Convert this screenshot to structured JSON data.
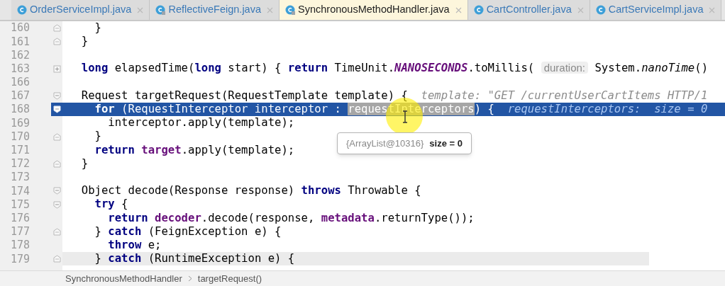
{
  "tabs": [
    {
      "name": "OrderServiceImpl.java",
      "selected": false,
      "library": false
    },
    {
      "name": "ReflectiveFeign.java",
      "selected": false,
      "library": true
    },
    {
      "name": "SynchronousMethodHandler.java",
      "selected": true,
      "library": true
    },
    {
      "name": "CartController.java",
      "selected": false,
      "library": false
    },
    {
      "name": "CartServiceImpl.java",
      "selected": false,
      "library": false
    }
  ],
  "lines": [
    {
      "number": "160",
      "fold_marker": {
        "kind": "end"
      },
      "execution": false,
      "caret": false,
      "tokens": [
        {
          "text": "    }",
          "kind": "plain"
        }
      ]
    },
    {
      "number": "161",
      "fold_marker": {
        "kind": "end"
      },
      "execution": false,
      "caret": false,
      "tokens": [
        {
          "text": "  }",
          "kind": "plain"
        }
      ]
    },
    {
      "number": "162",
      "execution": false,
      "caret": false
    },
    {
      "number": "163",
      "fold_marker": {
        "kind": "plus"
      },
      "execution": false,
      "caret": false,
      "tokens": [
        {
          "text": "  long",
          "kind": "keyword"
        },
        {
          "text": " elapsedTime(",
          "kind": "plain"
        },
        {
          "text": "long",
          "kind": "keyword"
        },
        {
          "text": " start) { ",
          "kind": "plain"
        },
        {
          "text": "return",
          "kind": "keyword"
        },
        {
          "text": " TimeUnit.",
          "kind": "plain"
        },
        {
          "text": "NANOSECONDS",
          "kind": "static"
        },
        {
          "text": ".toMillis( ",
          "kind": "plain"
        },
        {
          "text": "duration:",
          "kind": "hint"
        },
        {
          "text": " System.",
          "kind": "plain"
        },
        {
          "text": "nanoTime",
          "kind": "italic"
        },
        {
          "text": "()",
          "kind": "plain"
        }
      ]
    },
    {
      "number": "166",
      "execution": false,
      "caret": false
    },
    {
      "number": "167",
      "fold_marker": {
        "kind": "start"
      },
      "execution": false,
      "caret": false,
      "tokens": [
        {
          "text": "  Request targetRequest(RequestTemplate template) {  ",
          "kind": "plain"
        },
        {
          "text": "template: \"GET /currentUserCartItems HTTP/1",
          "kind": "debug"
        }
      ]
    },
    {
      "number": "168",
      "fold_marker": {
        "kind": "start"
      },
      "execution": true,
      "caret": false,
      "tokens": [
        {
          "text": "    for",
          "kind": "keyword"
        },
        {
          "text": " (RequestInterceptor interceptor : ",
          "kind": "plain"
        },
        {
          "text": "requestInterceptors",
          "kind": "selection"
        },
        {
          "text": ") {  ",
          "kind": "plain"
        },
        {
          "text": "requestInterceptors:  size = 0",
          "kind": "debug"
        }
      ]
    },
    {
      "number": "169",
      "execution": false,
      "caret": false,
      "tokens": [
        {
          "text": "      interceptor.apply(template);",
          "kind": "plain"
        }
      ]
    },
    {
      "number": "170",
      "fold_marker": {
        "kind": "end"
      },
      "execution": false,
      "caret": false,
      "tokens": [
        {
          "text": "    }",
          "kind": "plain"
        }
      ]
    },
    {
      "number": "171",
      "execution": false,
      "caret": false,
      "tokens": [
        {
          "text": "    return ",
          "kind": "keyword"
        },
        {
          "text": "target",
          "kind": "field"
        },
        {
          "text": ".apply(template);",
          "kind": "plain"
        }
      ]
    },
    {
      "number": "172",
      "fold_marker": {
        "kind": "end"
      },
      "execution": false,
      "caret": false,
      "tokens": [
        {
          "text": "  }",
          "kind": "plain"
        }
      ]
    },
    {
      "number": "173",
      "execution": false,
      "caret": false
    },
    {
      "number": "174",
      "fold_marker": {
        "kind": "start"
      },
      "execution": false,
      "caret": false,
      "tokens": [
        {
          "text": "  Object decode(Response response) ",
          "kind": "plain"
        },
        {
          "text": "throws",
          "kind": "keyword"
        },
        {
          "text": " Throwable {",
          "kind": "plain"
        }
      ]
    },
    {
      "number": "175",
      "fold_marker": {
        "kind": "start"
      },
      "execution": false,
      "caret": false,
      "tokens": [
        {
          "text": "    try",
          "kind": "keyword"
        },
        {
          "text": " {",
          "kind": "plain"
        }
      ]
    },
    {
      "number": "176",
      "execution": false,
      "caret": false,
      "tokens": [
        {
          "text": "      return ",
          "kind": "keyword"
        },
        {
          "text": "decoder",
          "kind": "field"
        },
        {
          "text": ".decode(response, ",
          "kind": "plain"
        },
        {
          "text": "metadata",
          "kind": "field"
        },
        {
          "text": ".returnType());",
          "kind": "plain"
        }
      ]
    },
    {
      "number": "177",
      "fold_marker": {
        "kind": "end"
      },
      "execution": false,
      "caret": false,
      "tokens": [
        {
          "text": "    } ",
          "kind": "plain"
        },
        {
          "text": "catch",
          "kind": "keyword"
        },
        {
          "text": " (FeignException e) {",
          "kind": "plain"
        }
      ]
    },
    {
      "number": "178",
      "execution": false,
      "caret": false,
      "tokens": [
        {
          "text": "      throw",
          "kind": "keyword"
        },
        {
          "text": " e;",
          "kind": "plain"
        }
      ]
    },
    {
      "number": "179",
      "fold_marker": {
        "kind": "end"
      },
      "execution": false,
      "caret": true,
      "tokens": [
        {
          "text": "    } ",
          "kind": "plain"
        },
        {
          "text": "catch",
          "kind": "keyword"
        },
        {
          "text": " (RuntimeException e) {",
          "kind": "plain"
        }
      ]
    }
  ],
  "tooltip": {
    "type": "{ArrayList@10316}",
    "value": "size = 0"
  },
  "breadcrumbs": [
    "SynchronousMethodHandler",
    "targetRequest()"
  ]
}
